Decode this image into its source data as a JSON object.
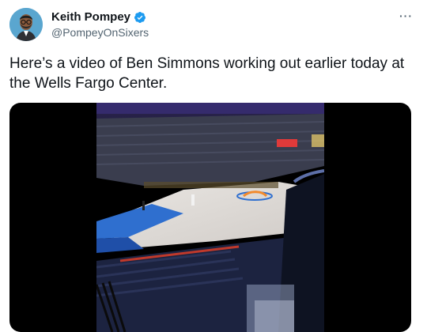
{
  "tweet": {
    "author_name": "Keith Pompey",
    "author_handle": "@PompeyOnSixers",
    "text": "Here’s a video of Ben Simmons working out earlier today at the Wells Fargo Center.",
    "more_label": "···"
  },
  "colors": {
    "verified": "#1d9bf0",
    "text": "#0f1419",
    "secondary": "#536471"
  },
  "icons": {
    "verified": "verified-badge-icon",
    "more": "more-options-icon"
  }
}
